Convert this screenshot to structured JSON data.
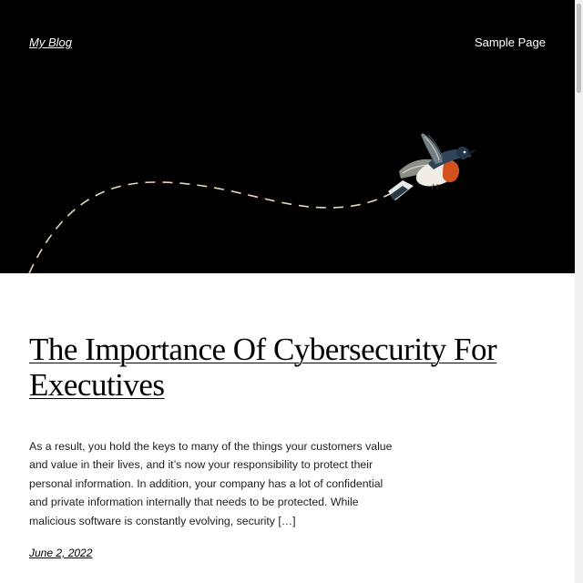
{
  "header": {
    "site_title": "My Blog",
    "nav": [
      {
        "label": "Sample Page"
      }
    ],
    "background_color": "#000000",
    "path_color": "#e8d6b8"
  },
  "post": {
    "title": "The Importance Of Cybersecurity For Executives",
    "excerpt": "As a result, you hold the keys to many of the things your customers value and value in their lives, and it’s now your responsibility to protect their personal information. In addition, your company has a lot of confidential and private information internally that needs to be protected. While malicious software is constantly evolving, security […]",
    "date": "June 2, 2022"
  }
}
